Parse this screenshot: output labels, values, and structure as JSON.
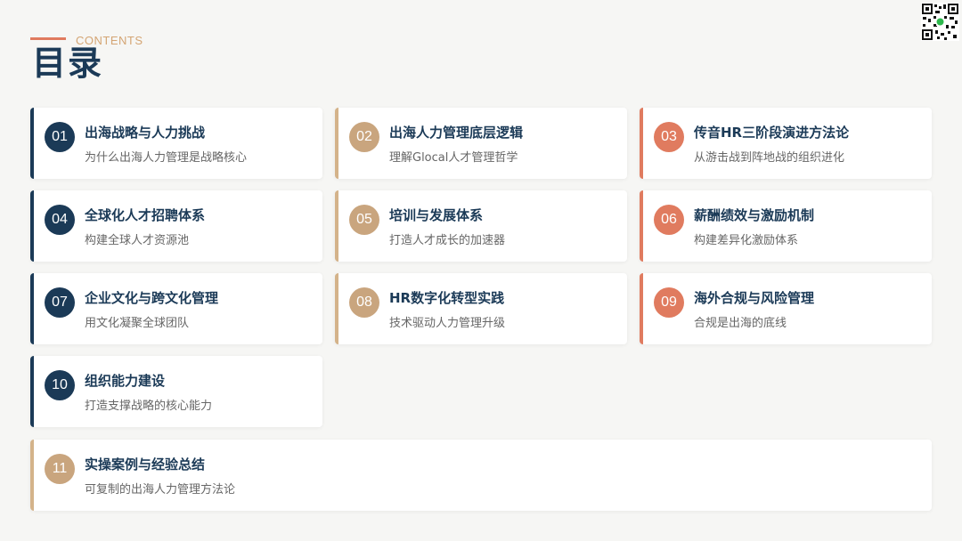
{
  "header": {
    "subtitle": "CONTENTS",
    "title": "目录"
  },
  "items": [
    {
      "num": "01",
      "title": "出海战略与人力挑战",
      "subtitle": "为什么出海人力管理是战略核心"
    },
    {
      "num": "02",
      "title": "出海人力管理底层逻辑",
      "subtitle": "理解Glocal人才管理哲学"
    },
    {
      "num": "03",
      "title": "传音HR三阶段演进方法论",
      "subtitle": "从游击战到阵地战的组织进化"
    },
    {
      "num": "04",
      "title": "全球化人才招聘体系",
      "subtitle": "构建全球人才资源池"
    },
    {
      "num": "05",
      "title": "培训与发展体系",
      "subtitle": "打造人才成长的加速器"
    },
    {
      "num": "06",
      "title": "薪酬绩效与激励机制",
      "subtitle": "构建差异化激励体系"
    },
    {
      "num": "07",
      "title": "企业文化与跨文化管理",
      "subtitle": "用文化凝聚全球团队"
    },
    {
      "num": "08",
      "title": "HR数字化转型实践",
      "subtitle": "技术驱动人力管理升级"
    },
    {
      "num": "09",
      "title": "海外合规与风险管理",
      "subtitle": "合规是出海的底线"
    },
    {
      "num": "10",
      "title": "组织能力建设",
      "subtitle": "打造支撑战略的核心能力"
    },
    {
      "num": "11",
      "title": "实操案例与经验总结",
      "subtitle": "可复制的出海人力管理方法论"
    }
  ],
  "colors": {
    "navy": "#1b3a57",
    "tan": "#c9a57e",
    "coral": "#e07b5f"
  },
  "qr_icon": "qr-code-icon"
}
